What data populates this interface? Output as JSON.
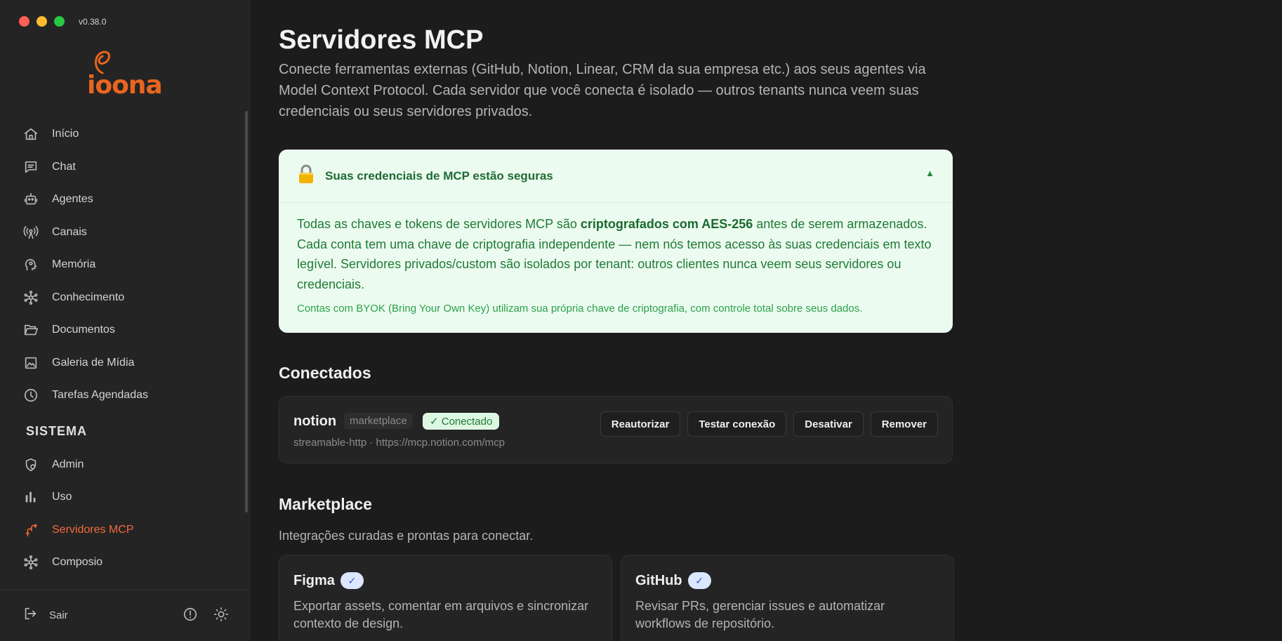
{
  "window": {
    "version": "v0.38.0"
  },
  "brand": {
    "name": "ioona",
    "color": "#e8651f"
  },
  "sidebar": {
    "items": [
      {
        "label": "Início",
        "icon": "home-icon"
      },
      {
        "label": "Chat",
        "icon": "chat-icon"
      },
      {
        "label": "Agentes",
        "icon": "robot-icon"
      },
      {
        "label": "Canais",
        "icon": "broadcast-icon"
      },
      {
        "label": "Memória",
        "icon": "brain-icon"
      },
      {
        "label": "Conhecimento",
        "icon": "network-icon"
      },
      {
        "label": "Documentos",
        "icon": "folder-icon"
      },
      {
        "label": "Galeria de Mídia",
        "icon": "image-icon"
      },
      {
        "label": "Tarefas Agendadas",
        "icon": "clock-icon"
      }
    ],
    "section_title": "SISTEMA",
    "system_items": [
      {
        "label": "Admin",
        "icon": "shield-user-icon"
      },
      {
        "label": "Uso",
        "icon": "bar-chart-icon"
      },
      {
        "label": "Servidores MCP",
        "icon": "plug-icon",
        "active": true
      },
      {
        "label": "Composio",
        "icon": "network-icon"
      }
    ],
    "logout_label": "Sair",
    "active_color": "#f06a3a"
  },
  "page": {
    "title": "Servidores MCP",
    "description": "Conecte ferramentas externas (GitHub, Notion, Linear, CRM da sua empresa etc.) aos seus agentes via Model Context Protocol. Cada servidor que você conecta é isolado — outros tenants nunca veem suas credenciais ou seus servidores privados."
  },
  "security": {
    "icon": "lock-icon",
    "title": "Suas credenciais de MCP estão seguras",
    "toggle": "▲",
    "body_pre": "Todas as chaves e tokens de servidores MCP são ",
    "body_bold": "criptografados com AES-256",
    "body_post": " antes de serem armazenados. Cada conta tem uma chave de criptografia independente — nem nós temos acesso às suas credenciais em texto legível. Servidores privados/custom são isolados por tenant: outros clientes nunca veem seus servidores ou credenciais.",
    "note": "Contas com BYOK (Bring Your Own Key) utilizam sua própria chave de criptografia, com controle total sobre seus dados."
  },
  "connected": {
    "heading": "Conectados",
    "servers": [
      {
        "name": "notion",
        "source_badge": "marketplace",
        "status": "✓ Conectado",
        "details": "streamable-http · https://mcp.notion.com/mcp",
        "actions": [
          "Reautorizar",
          "Testar conexão",
          "Desativar",
          "Remover"
        ]
      }
    ]
  },
  "marketplace": {
    "heading": "Marketplace",
    "subtitle": "Integrações curadas e prontas para conectar.",
    "cards": [
      {
        "name": "Figma",
        "verified": "✓",
        "description": "Exportar assets, comentar em arquivos e sincronizar contexto de design."
      },
      {
        "name": "GitHub",
        "verified": "✓",
        "description": "Revisar PRs, gerenciar issues e automatizar workflows de repositório."
      }
    ]
  }
}
